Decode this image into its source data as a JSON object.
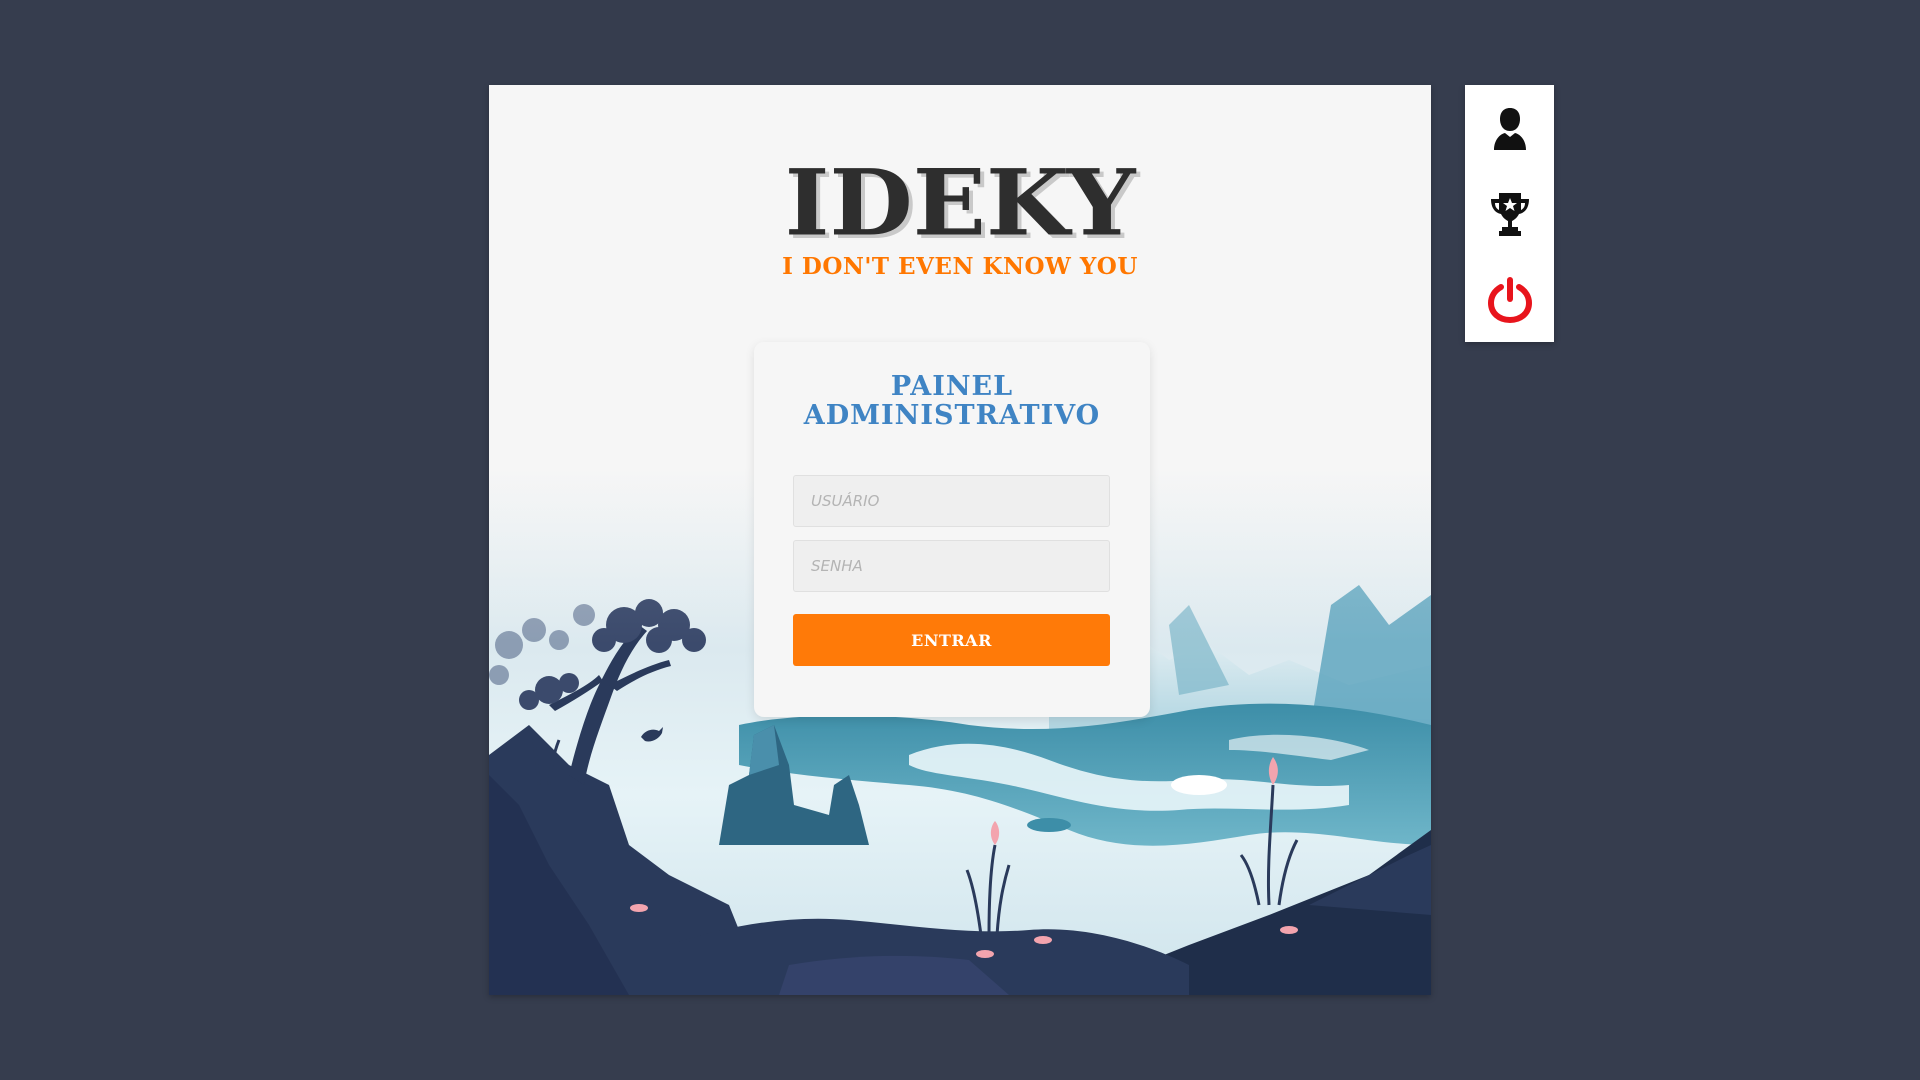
{
  "brand": {
    "name": "IDEKY",
    "tagline": "I DON'T EVEN KNOW YOU",
    "color_main": "#2e2e2e",
    "color_accent": "#ff7700"
  },
  "login": {
    "title_line1": "PAINEL",
    "title_line2": "ADMINISTRATIVO",
    "username_placeholder": "USUÁRIO",
    "password_placeholder": "SENHA",
    "submit_label": "ENTRAR",
    "title_color": "#3f84c4",
    "button_color": "#ff7a08"
  },
  "side_menu": {
    "items": [
      {
        "icon": "user-icon"
      },
      {
        "icon": "trophy-icon"
      },
      {
        "icon": "power-icon",
        "color": "#e8141c"
      }
    ]
  }
}
